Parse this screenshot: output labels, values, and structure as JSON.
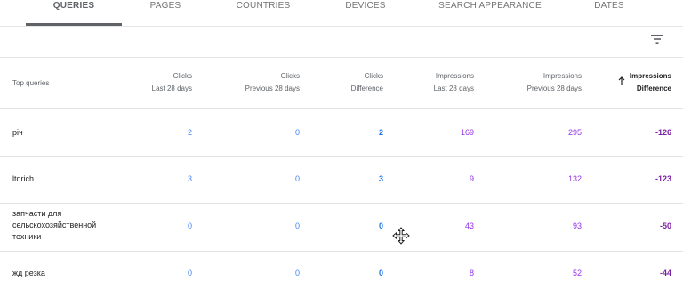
{
  "tabs": [
    "QUERIES",
    "PAGES",
    "COUNTRIES",
    "DEVICES",
    "SEARCH APPEARANCE",
    "DATES"
  ],
  "header": {
    "query_col": "Top queries",
    "clicks_last": [
      "Clicks",
      "Last 28 days"
    ],
    "clicks_prev": [
      "Clicks",
      "Previous 28 days"
    ],
    "clicks_diff": [
      "Clicks",
      "Difference"
    ],
    "impr_last": [
      "Impressions",
      "Last 28 days"
    ],
    "impr_prev": [
      "Impressions",
      "Previous 28 days"
    ],
    "impr_diff": [
      "Impressions",
      "Difference"
    ]
  },
  "rows": [
    {
      "query": "річ",
      "clicks_last": "2",
      "clicks_prev": "0",
      "clicks_diff": "2",
      "impr_last": "169",
      "impr_prev": "295",
      "impr_diff": "-126"
    },
    {
      "query": "ltdrich",
      "clicks_last": "3",
      "clicks_prev": "0",
      "clicks_diff": "3",
      "impr_last": "9",
      "impr_prev": "132",
      "impr_diff": "-123"
    },
    {
      "query": "запчасти для сельскохозяйственной техники",
      "clicks_last": "0",
      "clicks_prev": "0",
      "clicks_diff": "0",
      "impr_last": "43",
      "impr_prev": "93",
      "impr_diff": "-50"
    },
    {
      "query": "жд резка",
      "clicks_last": "0",
      "clicks_prev": "0",
      "clicks_diff": "0",
      "impr_last": "8",
      "impr_prev": "52",
      "impr_diff": "-44"
    }
  ],
  "colors": {
    "clicks": "#4285f4",
    "impressions": "#9334e6",
    "active_tab": "#5f6368"
  },
  "icons": {
    "filter": "filter-icon",
    "sort": "arrow-up-icon",
    "cursor": "move-cursor-icon"
  }
}
